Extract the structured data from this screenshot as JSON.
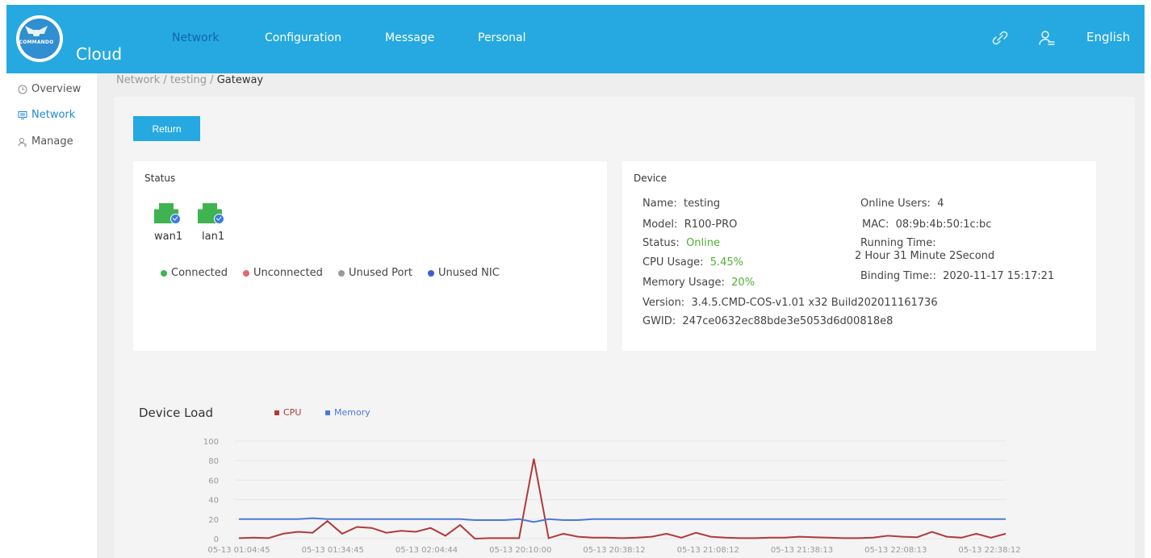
{
  "header": {
    "logo_text": "COMMANDO",
    "app_title": "Cloud",
    "nav": [
      "Network",
      "Configuration",
      "Message",
      "Personal"
    ],
    "active_nav": "Network",
    "language": "English",
    "icons": [
      "link-icon",
      "user-icon"
    ]
  },
  "sidebar": {
    "items": [
      {
        "label": "Overview",
        "icon": "clock-icon"
      },
      {
        "label": "Network",
        "icon": "monitor-icon",
        "active": true
      },
      {
        "label": "Manage",
        "icon": "user-icon"
      }
    ]
  },
  "breadcrumb": {
    "parts": [
      "Network",
      "testing",
      "Gateway"
    ],
    "sep": "/"
  },
  "actions": {
    "return_label": "Return"
  },
  "status_card": {
    "title": "Status",
    "ports": [
      {
        "label": "wan1"
      },
      {
        "label": "lan1"
      }
    ],
    "legend": [
      {
        "label": "Connected",
        "color": "#3eb34f"
      },
      {
        "label": "Unconnected",
        "color": "#e06a6a"
      },
      {
        "label": "Unused Port",
        "color": "#999999"
      },
      {
        "label": "Unused NIC",
        "color": "#3a5fd0"
      }
    ]
  },
  "device_card": {
    "title": "Device",
    "name_label": "Name:",
    "name": "testing",
    "model_label": "Model:",
    "model": "R100-PRO",
    "status_label": "Status:",
    "status": "Online",
    "cpu_label": "CPU Usage:",
    "cpu": "5.45%",
    "mem_label": "Memory Usage:",
    "mem": "20%",
    "version_label": "Version:",
    "version": "3.4.5.CMD-COS-v1.01 x32 Build202011161736",
    "gwid_label": "GWID:",
    "gwid": "247ce0632ec88bde3e5053d6d00818e8",
    "online_users_label": "Online Users:",
    "online_users": "4",
    "mac_label": "MAC:",
    "mac": "08:9b:4b:50:1c:bc",
    "running_time_label": "Running Time:",
    "running_time": "2 Hour 31 Minute 2Second",
    "binding_time_label": "Binding Time::",
    "binding_time": "2020-11-17 15:17:21"
  },
  "chart_title": "Device Load",
  "chart_data": {
    "type": "line",
    "y_ticks": [
      0,
      20,
      40,
      60,
      80,
      100
    ],
    "ylim": [
      0,
      100
    ],
    "x_ticks": [
      "05-13 01:04:45",
      "05-13 01:34:45",
      "05-13 02:04:44",
      "05-13 20:10:00",
      "05-13 20:38:12",
      "05-13 21:08:12",
      "05-13 21:38:13",
      "05-13 22:08:13",
      "05-13 22:38:12"
    ],
    "series": [
      {
        "name": "CPU",
        "color": "#b03a3a",
        "values": [
          0.5,
          1,
          0.5,
          5,
          7,
          6,
          18,
          5,
          12,
          11,
          6,
          8,
          7,
          11,
          3,
          14,
          0,
          0.5,
          0.5,
          0.5,
          82,
          0.5,
          5,
          2,
          1,
          1,
          0.5,
          1,
          2,
          5,
          1,
          6,
          2,
          1,
          0.5,
          0.5,
          1,
          1,
          2,
          1.5,
          1,
          0.5,
          0.5,
          1,
          3,
          2,
          1.5,
          7,
          2,
          1,
          5,
          1,
          5
        ]
      },
      {
        "name": "Memory",
        "color": "#4d79d6",
        "values": [
          20,
          20,
          20,
          20,
          20,
          21,
          20,
          20,
          20,
          20,
          20,
          20,
          20,
          20,
          20,
          20,
          19,
          19,
          19,
          20,
          17,
          20,
          19,
          19,
          20,
          20,
          20,
          20,
          20,
          20,
          20,
          20,
          20,
          20,
          20,
          20,
          20,
          20,
          20,
          20,
          20,
          20,
          20,
          20,
          20,
          20,
          20,
          20,
          20,
          20,
          20,
          20,
          20
        ]
      }
    ]
  }
}
